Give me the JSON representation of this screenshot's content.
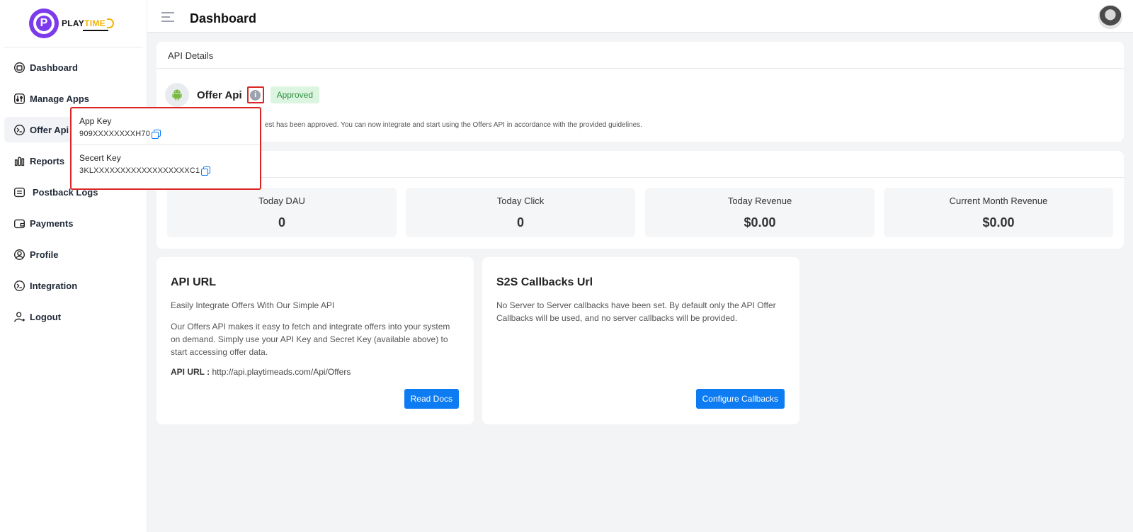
{
  "brand": {
    "play": "PLAY",
    "time": "TIME",
    "mark": "P"
  },
  "header": {
    "title": "Dashboard"
  },
  "sidebar": {
    "items": [
      {
        "label": "Dashboard",
        "icon": "dashboard-icon"
      },
      {
        "label": "Manage Apps",
        "icon": "manage-apps-icon"
      },
      {
        "label": "Offer Api",
        "icon": "terminal-icon",
        "active": true
      },
      {
        "label": "Reports",
        "icon": "bar-chart-icon"
      },
      {
        "label": "Postback Logs",
        "icon": "logs-icon"
      },
      {
        "label": "Payments",
        "icon": "wallet-icon"
      },
      {
        "label": "Profile",
        "icon": "user-icon"
      },
      {
        "label": "Integration",
        "icon": "terminal-icon"
      },
      {
        "label": "Logout",
        "icon": "logout-icon"
      }
    ]
  },
  "api_details": {
    "title": "API Details",
    "offer_title": "Offer Api",
    "status": "Approved",
    "status_color": "#2f8f3f",
    "message": "est has been approved. You can now integrate and start using the Offers API in accordance with the provided guidelines."
  },
  "popover": {
    "app_key_label": "App Key",
    "app_key_value": "909XXXXXXXXH70",
    "secret_key_label": "Secert Key",
    "secret_key_value": "3KLXXXXXXXXXXXXXXXXXXC1"
  },
  "stats": [
    {
      "label": "Today DAU",
      "value": "0"
    },
    {
      "label": "Today Click",
      "value": "0"
    },
    {
      "label": "Today Revenue",
      "value": "$0.00"
    },
    {
      "label": "Current Month Revenue",
      "value": "$0.00"
    }
  ],
  "api_url_card": {
    "title": "API URL",
    "subtitle": "Easily Integrate Offers With Our Simple API",
    "description": "Our Offers API makes it easy to fetch and integrate offers into your system on demand. Simply use your API Key and Secret Key (available above) to start accessing offer data.",
    "url_label": "API URL :",
    "url_value": "http://api.playtimeads.com/Api/Offers",
    "button": "Read Docs"
  },
  "callbacks_card": {
    "title": "S2S Callbacks Url",
    "description": "No Server to Server callbacks have been set. By default only the API Offer Callbacks will be used, and no server callbacks will be provided.",
    "button": "Configure Callbacks"
  },
  "colors": {
    "accent": "#0d7cf2",
    "brand": "#7c3aed",
    "highlight": "#dc2626"
  }
}
